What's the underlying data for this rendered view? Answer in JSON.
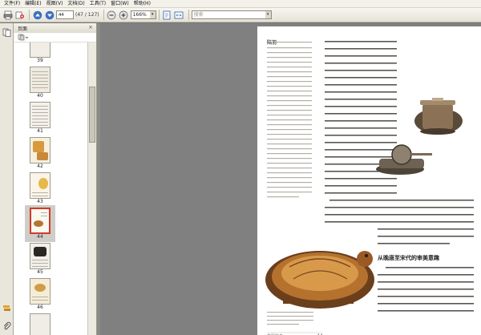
{
  "menu": [
    "文件(F)",
    "编辑(E)",
    "视图(V)",
    "文档(D)",
    "工具(T)",
    "窗口(W)",
    "帮助(H)"
  ],
  "toolbar": {
    "page_input": "44",
    "page_count": "(47 / 127)",
    "zoom": "166%",
    "search_placeholder": "搜索"
  },
  "pane": {
    "title": "页面",
    "thumbnails": [
      {
        "label": "39",
        "tone": "#f0ece2"
      },
      {
        "label": "40",
        "tone": "#eeeae0"
      },
      {
        "label": "41",
        "tone": "#f4f1ea"
      },
      {
        "label": "42",
        "tone": "#d9a54b"
      },
      {
        "label": "43",
        "tone": "#e7b84a"
      },
      {
        "label": "44",
        "tone": "#f6f2ea",
        "selected": true
      },
      {
        "label": "45",
        "tone": "#efece6"
      },
      {
        "label": "46",
        "tone": "#e4c77f"
      }
    ]
  },
  "page": {
    "sidebar_lead": "陆羽",
    "sidebar_text": "唐复州竟陵人，字鸿渐，一名疾，字季疵。自称桑苎翁，又号竟陵子。上元初，隐居苕溪，闭门著书。嗜茶，著《茶经》三卷，对茶的性状、品质、产地、种植、采制、烹饮、器具等皆有论述。后人尊为茶圣。",
    "col1_text": "的\"茶瓷\"或\"越州瓷\"。唐代，皇室饮茶使用的茶碗茶具质地较高。我国唐代最优秀的茶碗。陆羽在《茶经》中将越州与邢州进行了比较，认为越窑青瓷如玉，邢窑白瓷如银。越瓷青而茶色绿，邢瓷白而茶色红。",
    "col2_text": "法门寺地宫出土了成套的宫廷茶具。皇家的饮茶器具极为讲究，质地精美，工艺考究，是唐代茶文化高度发展的重要标志，展现了盛唐饮茶的风貌。",
    "caption_left": "鎏金飞鸿球路纹银笼子，是唐代宫廷贮茶饼用的器具，制作精美。",
    "section_title": "从晚唐至宋代的审美意趣",
    "section_text": "晚唐《茶经》问世以后，从事茶叶生产的人员增多，饮茶风气普遍。宋人更重视茶的品质与风雅，茶具的色泽与器形都发生了变化，推崇黑釉茶盏，以衬托茶汤的白色汤花，形成了独特的审美意趣。",
    "page_number": "44",
    "footer_caption": "茶器竹鸟"
  }
}
